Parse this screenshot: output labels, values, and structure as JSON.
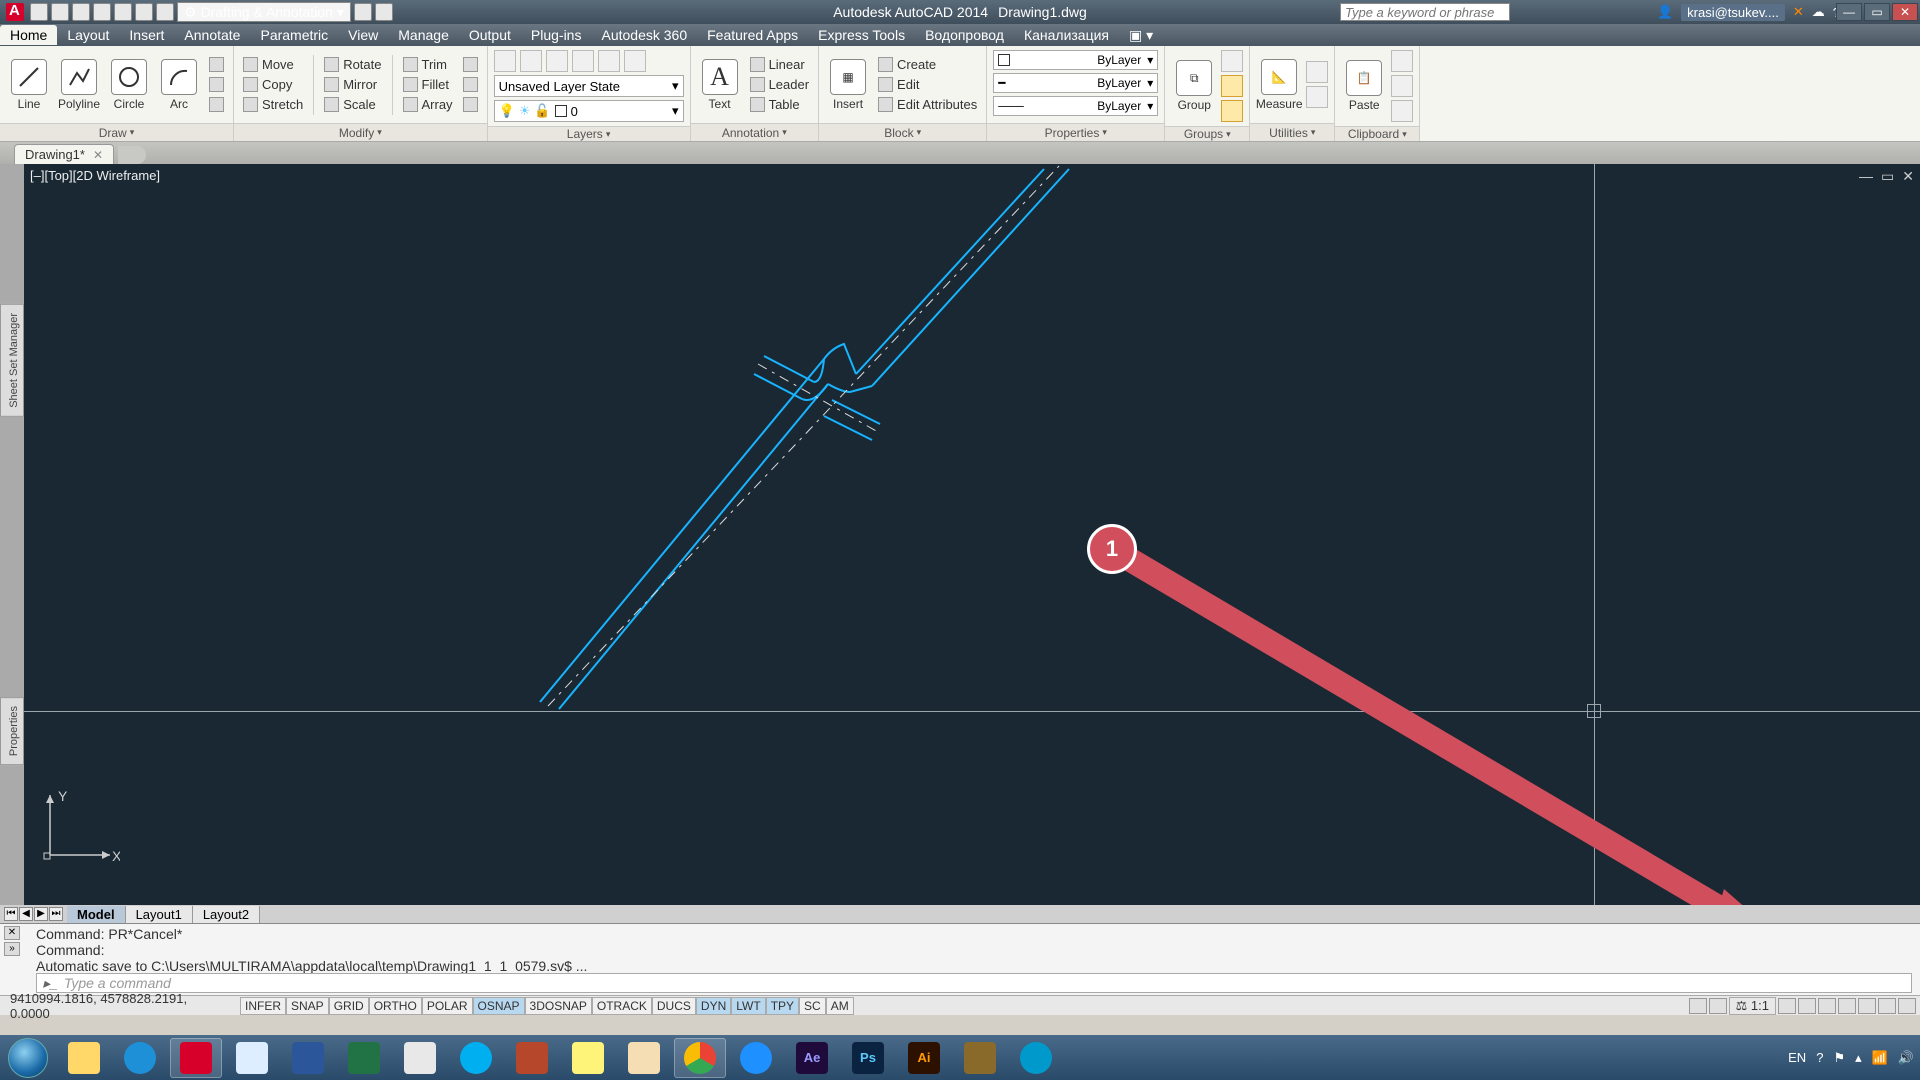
{
  "title": {
    "app": "Autodesk AutoCAD 2014",
    "file": "Drawing1.dwg"
  },
  "workspace": "Drafting & Annotation",
  "search_placeholder": "Type a keyword or phrase",
  "user": "krasi@tsukev....",
  "menus": [
    "Home",
    "Layout",
    "Insert",
    "Annotate",
    "Parametric",
    "View",
    "Manage",
    "Output",
    "Plug-ins",
    "Autodesk 360",
    "Featured Apps",
    "Express Tools",
    "Водопровод",
    "Канализация"
  ],
  "active_menu": "Home",
  "ribbon": {
    "draw": {
      "title": "Draw",
      "items": [
        "Line",
        "Polyline",
        "Circle",
        "Arc"
      ]
    },
    "modify": {
      "title": "Modify",
      "rows": [
        [
          "Move",
          "Rotate",
          "Trim"
        ],
        [
          "Copy",
          "Mirror",
          "Fillet"
        ],
        [
          "Stretch",
          "Scale",
          "Array"
        ]
      ]
    },
    "layers": {
      "title": "Layers",
      "state": "Unsaved Layer State",
      "current": "0"
    },
    "annotation": {
      "title": "Annotation",
      "text": "Text",
      "items": [
        "Linear",
        "Leader",
        "Table"
      ]
    },
    "block": {
      "title": "Block",
      "insert": "Insert",
      "items": [
        "Create",
        "Edit",
        "Edit Attributes"
      ]
    },
    "properties": {
      "title": "Properties",
      "color": "ByLayer",
      "line1": "ByLayer",
      "line2": "ByLayer"
    },
    "groups": {
      "title": "Groups",
      "label": "Group"
    },
    "utilities": {
      "title": "Utilities",
      "label": "Measure"
    },
    "clipboard": {
      "title": "Clipboard",
      "label": "Paste"
    }
  },
  "doc_tab": "Drawing1*",
  "viewport_label": "[‒][Top][2D Wireframe]",
  "ucs": {
    "x": "X",
    "y": "Y"
  },
  "annotation_marker": "1",
  "layout_tabs": [
    "Model",
    "Layout1",
    "Layout2"
  ],
  "active_layout": "Model",
  "command": {
    "hist": [
      "Command: PR*Cancel*",
      "Command:",
      "Automatic save to C:\\Users\\MULTIRAMA\\appdata\\local\\temp\\Drawing1_1_1_0579.sv$ ...",
      "Command:"
    ],
    "prompt": "Type a command"
  },
  "status": {
    "coords": "9410994.1816, 4578828.2191, 0.0000",
    "toggles": [
      "INFER",
      "SNAP",
      "GRID",
      "ORTHO",
      "POLAR",
      "OSNAP",
      "3DOSNAP",
      "OTRACK",
      "DUCS",
      "DYN",
      "LWT",
      "TPY",
      "SC",
      "AM"
    ],
    "toggles_on": [
      "OSNAP",
      "DYN",
      "LWT",
      "TPY"
    ],
    "scale": "1:1"
  },
  "tray": {
    "lang": "EN",
    "time": ""
  },
  "colors": {
    "viewport": "#1a2833",
    "drawing_line": "#18b4ff",
    "anno": "#d14e5c"
  }
}
